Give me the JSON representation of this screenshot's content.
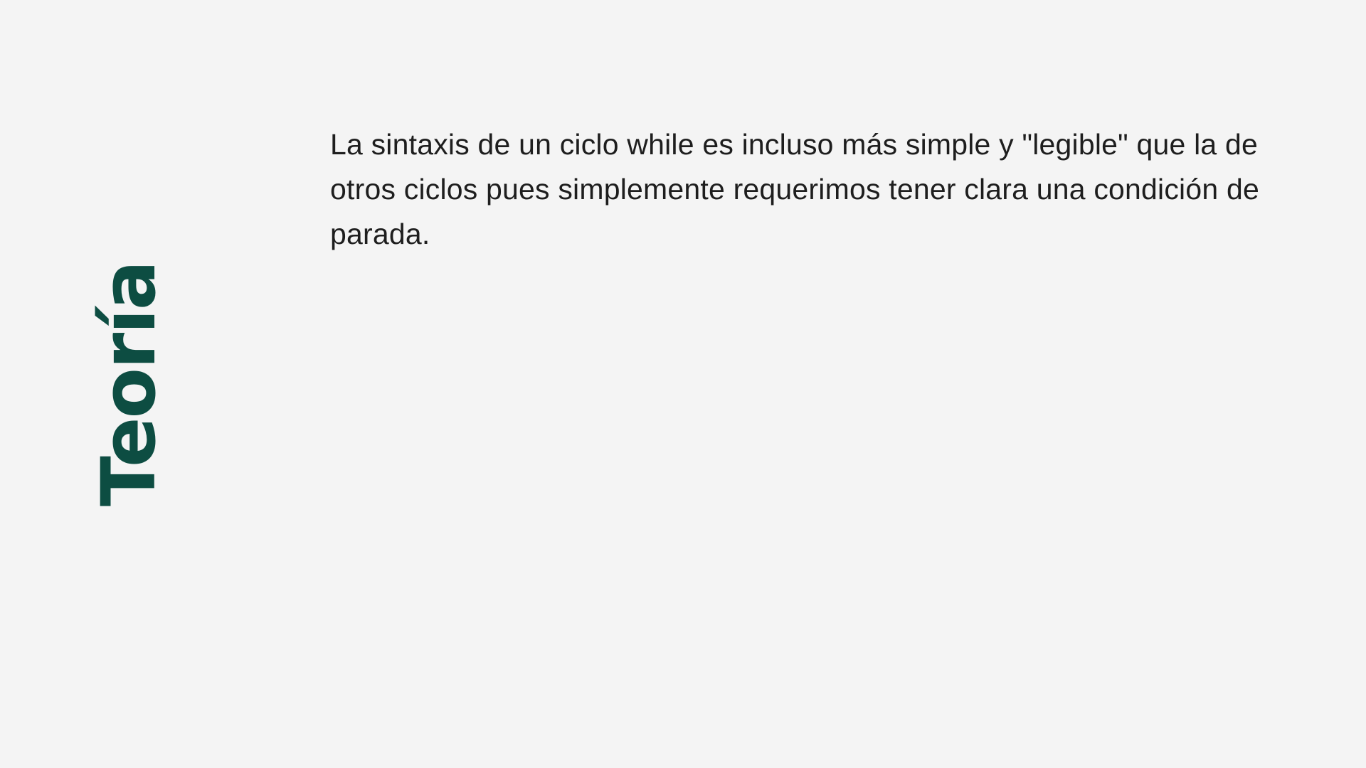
{
  "slide": {
    "side_title": "Teoría",
    "body": "La sintaxis de un ciclo while es incluso más simple y \"legible\" que la de otros ciclos pues simplemente requerimos tener clara una condición de parada."
  },
  "colors": {
    "background": "#f4f4f4",
    "title": "#0d4d42",
    "text": "#1e1e1e"
  }
}
